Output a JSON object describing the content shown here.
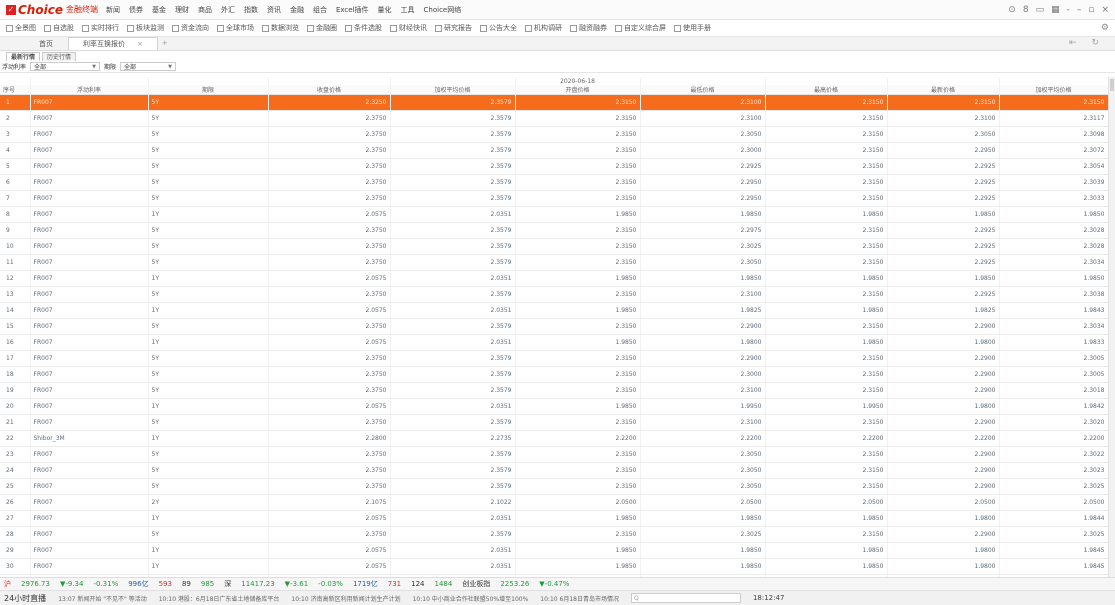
{
  "app": {
    "logo_mark": "✓",
    "logo_text": "Choice",
    "logo_sub": "金融终端",
    "menu": [
      "新闻",
      "债券",
      "基金",
      "理财",
      "商品",
      "外汇",
      "指数",
      "资讯",
      "金融",
      "组合",
      "Excel插件",
      "量化",
      "工具",
      "Choice网络"
    ],
    "window_controls": [
      "⊙",
      "8",
      "▭",
      "▦",
      "-",
      "–",
      "▫",
      "×"
    ]
  },
  "toolbar": {
    "items": [
      "全景图",
      "自选股",
      "实时排行",
      "板块监测",
      "资金流向",
      "全球市场",
      "数据浏览",
      "金融圈",
      "条件选股",
      "财经快讯",
      "研究报告",
      "公告大全",
      "机构调研",
      "融资融券",
      "自定义综合屏",
      "使用手册"
    ],
    "right_icon": "⚙"
  },
  "tabs": [
    {
      "label": "首页",
      "active": false
    },
    {
      "label": "利率互换报价",
      "active": true,
      "close": "×"
    }
  ],
  "tabs_plus": "+",
  "tabs_right": "⇤ ↻",
  "subtabs": [
    {
      "label": "最新行情",
      "active": true
    },
    {
      "label": "历史行情",
      "active": false
    }
  ],
  "filters": {
    "rate_label": "浮动利率",
    "rate_value": "全部",
    "term_label": "期限",
    "term_value": "全部",
    "arrow": "▼"
  },
  "table": {
    "date": "2020-06-18",
    "columns": [
      "序号",
      "浮动利率",
      "期限",
      "收盘价格",
      "加权平均价格",
      "开盘价格",
      "最低价格",
      "最高价格",
      "最新价格",
      "加权平均价格"
    ],
    "rows": [
      [
        "1",
        "FR007",
        "5Y",
        "2.3250",
        "2.3579",
        "2.3150",
        "2.3100",
        "2.3150",
        "2.3150",
        "2.3150"
      ],
      [
        "2",
        "FR007",
        "5Y",
        "2.3750",
        "2.3579",
        "2.3150",
        "2.3100",
        "2.3150",
        "2.3100",
        "2.3117"
      ],
      [
        "3",
        "FR007",
        "5Y",
        "2.3750",
        "2.3579",
        "2.3150",
        "2.3050",
        "2.3150",
        "2.3050",
        "2.3098"
      ],
      [
        "4",
        "FR007",
        "5Y",
        "2.3750",
        "2.3579",
        "2.3150",
        "2.3000",
        "2.3150",
        "2.2950",
        "2.3072"
      ],
      [
        "5",
        "FR007",
        "5Y",
        "2.3750",
        "2.3579",
        "2.3150",
        "2.2925",
        "2.3150",
        "2.2925",
        "2.3054"
      ],
      [
        "6",
        "FR007",
        "5Y",
        "2.3750",
        "2.3579",
        "2.3150",
        "2.2950",
        "2.3150",
        "2.2925",
        "2.3039"
      ],
      [
        "7",
        "FR007",
        "5Y",
        "2.3750",
        "2.3579",
        "2.3150",
        "2.2950",
        "2.3150",
        "2.2925",
        "2.3033"
      ],
      [
        "8",
        "FR007",
        "1Y",
        "2.0575",
        "2.0351",
        "1.9850",
        "1.9850",
        "1.9850",
        "1.9850",
        "1.9850"
      ],
      [
        "9",
        "FR007",
        "5Y",
        "2.3750",
        "2.3579",
        "2.3150",
        "2.2975",
        "2.3150",
        "2.2925",
        "2.3028"
      ],
      [
        "10",
        "FR007",
        "5Y",
        "2.3750",
        "2.3579",
        "2.3150",
        "2.3025",
        "2.3150",
        "2.2925",
        "2.3028"
      ],
      [
        "11",
        "FR007",
        "5Y",
        "2.3750",
        "2.3579",
        "2.3150",
        "2.3050",
        "2.3150",
        "2.2925",
        "2.3034"
      ],
      [
        "12",
        "FR007",
        "1Y",
        "2.0575",
        "2.0351",
        "1.9850",
        "1.9850",
        "1.9850",
        "1.9850",
        "1.9850"
      ],
      [
        "13",
        "FR007",
        "5Y",
        "2.3750",
        "2.3579",
        "2.3150",
        "2.3100",
        "2.3150",
        "2.2925",
        "2.3038"
      ],
      [
        "14",
        "FR007",
        "1Y",
        "2.0575",
        "2.0351",
        "1.9850",
        "1.9825",
        "1.9850",
        "1.9825",
        "1.9843"
      ],
      [
        "15",
        "FR007",
        "5Y",
        "2.3750",
        "2.3579",
        "2.3150",
        "2.2900",
        "2.3150",
        "2.2900",
        "2.3034"
      ],
      [
        "16",
        "FR007",
        "1Y",
        "2.0575",
        "2.0351",
        "1.9850",
        "1.9800",
        "1.9850",
        "1.9800",
        "1.9833"
      ],
      [
        "17",
        "FR007",
        "5Y",
        "2.3750",
        "2.3579",
        "2.3150",
        "2.2900",
        "2.3150",
        "2.2900",
        "2.3005"
      ],
      [
        "18",
        "FR007",
        "5Y",
        "2.3750",
        "2.3579",
        "2.3150",
        "2.3000",
        "2.3150",
        "2.2900",
        "2.3005"
      ],
      [
        "19",
        "FR007",
        "5Y",
        "2.3750",
        "2.3579",
        "2.3150",
        "2.3100",
        "2.3150",
        "2.2900",
        "2.3018"
      ],
      [
        "20",
        "FR007",
        "1Y",
        "2.0575",
        "2.0351",
        "1.9850",
        "1.9950",
        "1.9950",
        "1.9800",
        "1.9842"
      ],
      [
        "21",
        "FR007",
        "5Y",
        "2.3750",
        "2.3579",
        "2.3150",
        "2.3100",
        "2.3150",
        "2.2900",
        "2.3020"
      ],
      [
        "22",
        "Shibor_3M",
        "1Y",
        "2.2800",
        "2.2735",
        "2.2200",
        "2.2200",
        "2.2200",
        "2.2200",
        "2.2200"
      ],
      [
        "23",
        "FR007",
        "5Y",
        "2.3750",
        "2.3579",
        "2.3150",
        "2.3050",
        "2.3150",
        "2.2900",
        "2.3022"
      ],
      [
        "24",
        "FR007",
        "5Y",
        "2.3750",
        "2.3579",
        "2.3150",
        "2.3050",
        "2.3150",
        "2.2900",
        "2.3023"
      ],
      [
        "25",
        "FR007",
        "5Y",
        "2.3750",
        "2.3579",
        "2.3150",
        "2.3050",
        "2.3150",
        "2.2900",
        "2.3025"
      ],
      [
        "26",
        "FR007",
        "2Y",
        "2.1075",
        "2.1022",
        "2.0500",
        "2.0500",
        "2.0500",
        "2.0500",
        "2.0500"
      ],
      [
        "27",
        "FR007",
        "1Y",
        "2.0575",
        "2.0351",
        "1.9850",
        "1.9850",
        "1.9850",
        "1.9800",
        "1.9844"
      ],
      [
        "28",
        "FR007",
        "5Y",
        "2.3750",
        "2.3579",
        "2.3150",
        "2.3025",
        "2.3150",
        "2.2900",
        "2.3025"
      ],
      [
        "29",
        "FR007",
        "1Y",
        "2.0575",
        "2.0351",
        "1.9850",
        "1.9850",
        "1.9850",
        "1.9800",
        "1.9845"
      ],
      [
        "30",
        "FR007",
        "1Y",
        "2.0575",
        "2.0351",
        "1.9850",
        "1.9850",
        "1.9850",
        "1.9800",
        "1.9845"
      ],
      [
        "31",
        "FR007",
        "5Y",
        "2.3750",
        "2.3579",
        "2.3150",
        "2.3025",
        "2.3150",
        "2.2900",
        "2.3025"
      ],
      [
        "32",
        "FR007",
        "5Y",
        "2.3750",
        "2.3579",
        "2.3150",
        "2.3050",
        "2.3150",
        "2.2900",
        "2.3026"
      ]
    ]
  },
  "status": {
    "sh_label": "沪",
    "sh_value": "2976.73",
    "sh_change": "▼-9.34",
    "sh_pct": "-0.31%",
    "sh_vol": "996亿",
    "up": "593",
    "flat": "89",
    "down": "985",
    "sz_label": "深",
    "sz_value": "11417.23",
    "sz_change": "▼-3.61",
    "sz_pct": "-0.03%",
    "sz_vol": "1719亿",
    "up2": "731",
    "flat2": "124",
    "down2": "1484",
    "label3": "创业板指",
    "cy_value": "2253.26",
    "cy_change": "▼-0.47%",
    "colors": {
      "up": "#e02a2a",
      "down": "#1f9a3a"
    }
  },
  "news": {
    "live": "24小时直播",
    "items": [
      "13:07 新闻开始 \"不见不\" 等活动",
      "10:10 港股：6月18日广东省土地储备库平台",
      "10:10 济南高新区利用新闻计划生产计划",
      "10:10 中小商业合作社联盟50%增至100%",
      "10:10 6月18日青岛市场情况"
    ],
    "search_placeholder": "Q",
    "time": "18:12:47"
  }
}
